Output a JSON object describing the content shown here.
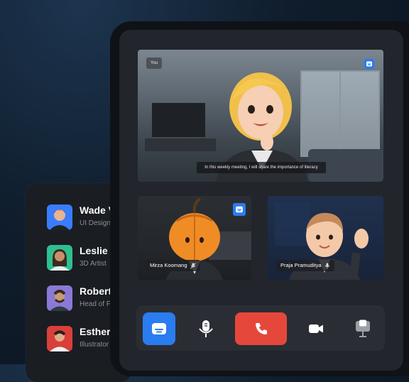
{
  "participants": [
    {
      "name": "Wade V",
      "role": "UI Design"
    },
    {
      "name": "Leslie A",
      "role": "3D Artist"
    },
    {
      "name": "Robert",
      "role": "Head of F"
    },
    {
      "name": "Esther",
      "role": "Illustrator"
    }
  ],
  "main_video": {
    "you_label": "You",
    "caption": "In this weekly meeting, I will share the importance of literacy"
  },
  "tiles": [
    {
      "name": "Mirza Koomang"
    },
    {
      "name": "Praja Pramuditya"
    }
  ],
  "colors": {
    "accent": "#2a7cf0",
    "end_call": "#e5483b",
    "panel": "#22262c"
  },
  "controls": [
    {
      "icon": "captions-icon",
      "active": true
    },
    {
      "icon": "microphone-icon"
    },
    {
      "icon": "phone-icon"
    },
    {
      "icon": "video-camera-icon"
    },
    {
      "icon": "screen-share-icon"
    }
  ]
}
